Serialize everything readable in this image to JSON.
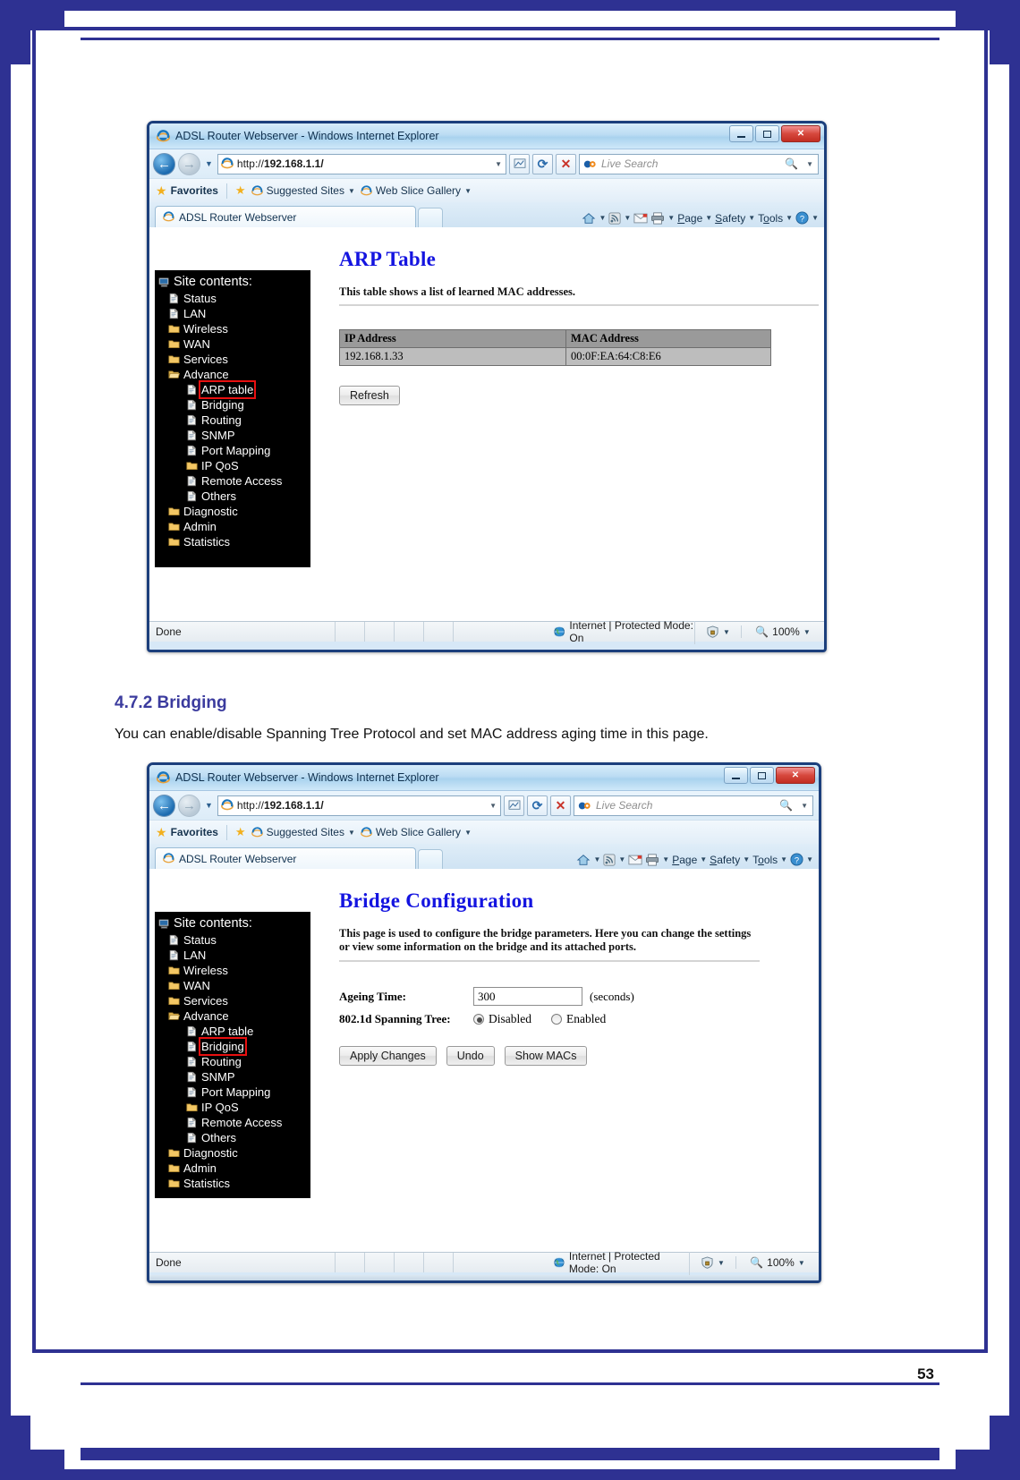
{
  "document": {
    "section_heading": "4.7.2 Bridging",
    "section_paragraph": "You can enable/disable Spanning Tree Protocol and set MAC address aging time in this page.",
    "page_number": "53"
  },
  "browser": {
    "window_title": "ADSL Router Webserver - Windows Internet Explorer",
    "address_value": "http://192.168.1.1/",
    "address_prefix": "http://",
    "address_host": "192.168.1.1/",
    "search_placeholder": "Live Search",
    "favorites_label": "Favorites",
    "suggested_sites_label": "Suggested Sites",
    "web_slice_label": "Web Slice Gallery",
    "tab_label": "ADSL Router Webserver",
    "command_bar": {
      "home": "home-icon",
      "feeds": "feeds-icon",
      "mail": "mail-icon",
      "print": "print-icon",
      "page": "Page",
      "safety": "Safety",
      "tools": "Tools",
      "help": "help-icon"
    },
    "window_buttons": {
      "minimize": "minimize-icon",
      "maximize": "maximize-icon",
      "close": "✕"
    },
    "status": {
      "state": "Done",
      "zone": "Internet | Protected Mode: On",
      "zoom": "100%"
    }
  },
  "sidebar": {
    "root_label": "Site contents:",
    "items": [
      {
        "label": "Status",
        "level": 1,
        "icon": "page-icon",
        "selected": false
      },
      {
        "label": "LAN",
        "level": 1,
        "icon": "page-icon",
        "selected": false
      },
      {
        "label": "Wireless",
        "level": 1,
        "icon": "folder-icon",
        "selected": false
      },
      {
        "label": "WAN",
        "level": 1,
        "icon": "folder-icon",
        "selected": false
      },
      {
        "label": "Services",
        "level": 1,
        "icon": "folder-icon",
        "selected": false
      },
      {
        "label": "Advance",
        "level": 1,
        "icon": "folder-open-icon",
        "selected": false
      },
      {
        "label": "ARP table",
        "level": 2,
        "icon": "page-icon",
        "selected": true
      },
      {
        "label": "Bridging",
        "level": 2,
        "icon": "page-icon",
        "selected": false
      },
      {
        "label": "Routing",
        "level": 2,
        "icon": "page-icon",
        "selected": false
      },
      {
        "label": "SNMP",
        "level": 2,
        "icon": "page-icon",
        "selected": false
      },
      {
        "label": "Port Mapping",
        "level": 2,
        "icon": "page-icon",
        "selected": false
      },
      {
        "label": "IP QoS",
        "level": 2,
        "icon": "folder-icon",
        "selected": false
      },
      {
        "label": "Remote Access",
        "level": 2,
        "icon": "page-icon",
        "selected": false
      },
      {
        "label": "Others",
        "level": 2,
        "icon": "page-icon",
        "selected": false
      },
      {
        "label": "Diagnostic",
        "level": 1,
        "icon": "folder-icon",
        "selected": false
      },
      {
        "label": "Admin",
        "level": 1,
        "icon": "folder-icon",
        "selected": false
      },
      {
        "label": "Statistics",
        "level": 1,
        "icon": "folder-icon",
        "selected": false
      }
    ],
    "selected_arp": "ARP table",
    "selected_bridging": "Bridging"
  },
  "arp_page": {
    "title": "ARP Table",
    "description": "This table shows a list of learned MAC addresses.",
    "table": {
      "headers": [
        "IP Address",
        "MAC Address"
      ],
      "rows": [
        [
          "192.168.1.33",
          "00:0F:EA:64:C8:E6"
        ]
      ]
    },
    "refresh_label": "Refresh"
  },
  "bridge_page": {
    "title": "Bridge Configuration",
    "description": "This page is used to configure the bridge parameters. Here you can change the settings or view some information on the bridge and its attached ports.",
    "ageing_label": "Ageing Time:",
    "ageing_value": "300",
    "ageing_unit": "(seconds)",
    "stp_label": "802.1d Spanning Tree:",
    "stp_options": [
      {
        "label": "Disabled",
        "selected": true
      },
      {
        "label": "Enabled",
        "selected": false
      }
    ],
    "apply_label": "Apply Changes",
    "undo_label": "Undo",
    "show_macs_label": "Show MACs"
  },
  "colors": {
    "border_blue": "#2e3192",
    "heading_blue": "#3b3b9e",
    "page_title_blue": "#1414e0",
    "selection_red": "#e81010",
    "nav_background": "#000000"
  }
}
